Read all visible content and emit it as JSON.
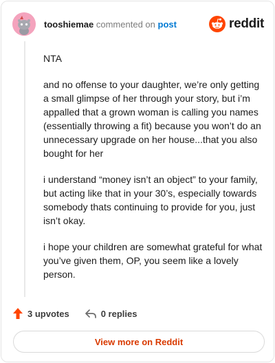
{
  "header": {
    "username": "tooshiemae",
    "action_text": "commented on",
    "link_text": "post",
    "logo_text": "reddit",
    "avatar_icon": "snoo-avatar-icon",
    "logo_icon": "reddit-snoo-icon",
    "brand_color": "#ff4500"
  },
  "comment": {
    "paragraphs": [
      "NTA",
      "and no offense to your daughter, we’re only getting a small glimpse of her through your story, but i’m appalled that a grown woman is calling you names (essentially throwing a fit) because you won’t do an unnecessary upgrade on her house...that you also bought for her",
      "i understand “money isn’t an object” to your family, but acting like that in your 30’s, especially towards somebody thats continuing to provide for you, just isn’t okay.",
      "i hope your children are somewhat grateful for what you’ve given them, OP, you seem like a lovely person."
    ]
  },
  "actions": {
    "upvotes_label": "3 upvotes",
    "replies_label": "0 replies",
    "upvote_icon": "upvote-arrow-icon",
    "reply_icon": "reply-arrow-icon"
  },
  "footer": {
    "view_more_label": "View more on Reddit"
  }
}
